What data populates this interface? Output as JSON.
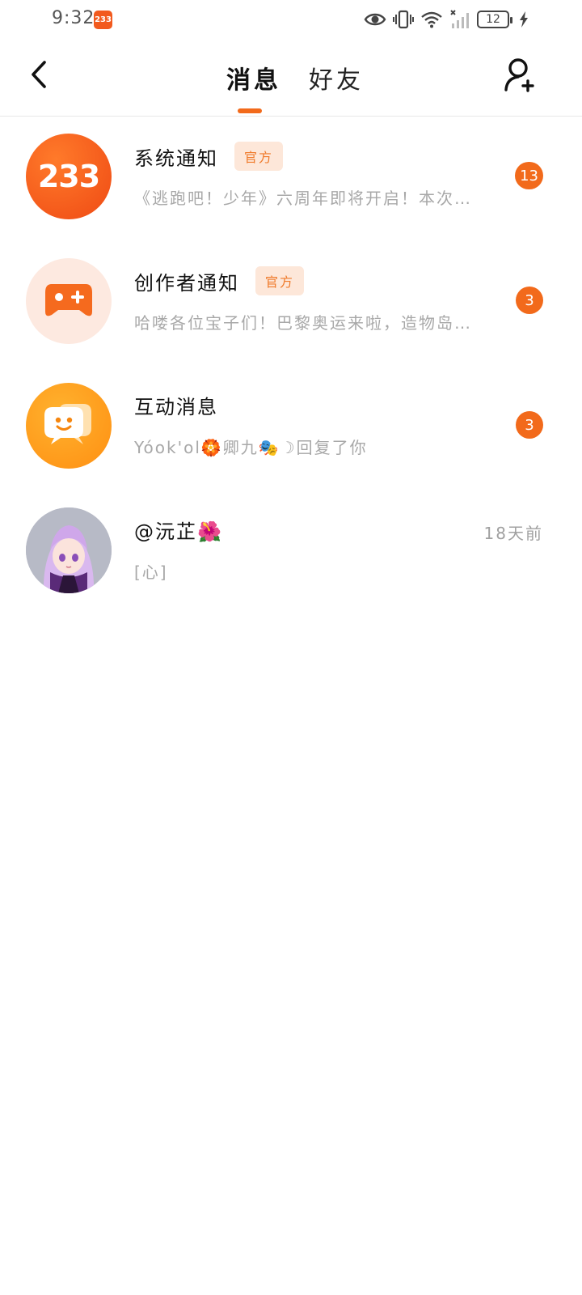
{
  "status_bar": {
    "time": "9:32",
    "app_icon_text": "233",
    "battery_level": "12"
  },
  "header": {
    "tabs": [
      {
        "label": "消息",
        "active": true
      },
      {
        "label": "好友",
        "active": false
      }
    ],
    "icons": {
      "back": "chevron-left-icon",
      "add_friend": "add-user-icon"
    }
  },
  "conversations": [
    {
      "title": "系统通知",
      "badge": "官方",
      "preview": "《逃跑吧！少年》六周年即将开启！本次…",
      "unread": "13",
      "avatar": "logo-233"
    },
    {
      "title": "创作者通知",
      "badge": "官方",
      "preview": "哈喽各位宝子们！巴黎奥运来啦，造物岛…",
      "unread": "3",
      "avatar": "gamepad-plus-icon"
    },
    {
      "title": "互动消息",
      "preview": "Yóok'ol🏵️卿九🎭☽回复了你",
      "unread": "3",
      "avatar": "chat-smile-icon"
    },
    {
      "title": "@沅芷🌺",
      "preview": "[心]",
      "time": "18天前",
      "avatar": "user-avatar"
    }
  ],
  "colors": {
    "accent": "#f26a1b",
    "badge_bg": "#fde7d9",
    "badge_text": "#f07a2a",
    "muted_text": "#a8a8a8"
  }
}
